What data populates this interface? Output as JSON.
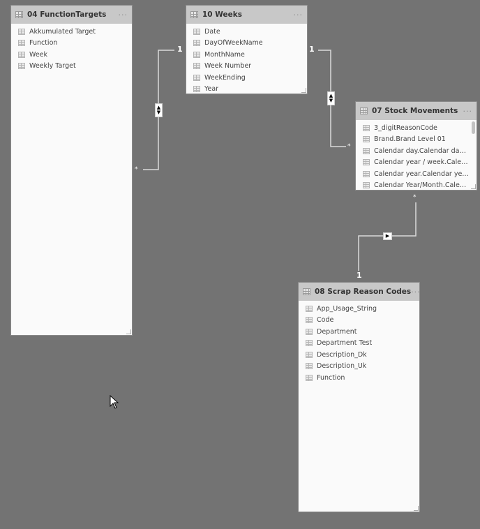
{
  "tables": [
    {
      "title": "04 FunctionTargets",
      "more_label": "···",
      "fields": [
        "Akkumulated Target",
        "Function",
        "Week",
        "Weekly Target"
      ]
    },
    {
      "title": "10 Weeks",
      "more_label": "···",
      "fields": [
        "Date",
        "DayOfWeekName",
        "MonthName",
        "Week Number",
        "WeekEnding",
        "Year"
      ]
    },
    {
      "title": "07 Stock Movements",
      "more_label": "···",
      "fields": [
        "3_digitReasonCode",
        "Brand.Brand Level 01",
        "Calendar day.Calendar day L...",
        "Calendar year / week.Calend...",
        "Calendar year.Calendar year ...",
        "Calendar Year/Month.Calend..."
      ]
    },
    {
      "title": "08 Scrap Reason Codes",
      "more_label": "···",
      "fields": [
        "App_Usage_String",
        "Code",
        "Department",
        "Department Test",
        "Description_Dk",
        "Description_Uk",
        "Function"
      ]
    }
  ],
  "relationships": [
    {
      "from": "04 FunctionTargets",
      "to": "10 Weeks",
      "from_cardinality": "*",
      "to_cardinality": "1",
      "cross_filter": "both"
    },
    {
      "from": "07 Stock Movements",
      "to": "10 Weeks",
      "from_cardinality": "*",
      "to_cardinality": "1",
      "cross_filter": "both"
    },
    {
      "from": "07 Stock Movements",
      "to": "08 Scrap Reason Codes",
      "from_cardinality": "*",
      "to_cardinality": "1",
      "cross_filter": "single"
    }
  ],
  "labels": {
    "one": "1",
    "many": "*",
    "both_up": "▲",
    "both_down": "▼",
    "single_arrow": "▶"
  }
}
